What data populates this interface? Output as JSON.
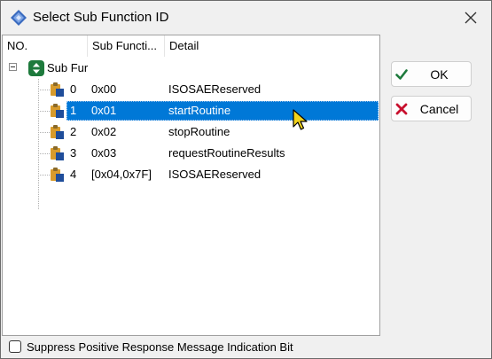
{
  "window": {
    "title": "Select Sub Function ID",
    "colors": {
      "selection": "#0078d7",
      "ok_check": "#1e7a3c",
      "cancel_x": "#c8102e"
    }
  },
  "tree": {
    "columns": [
      "NO.",
      "Sub Functi...",
      "Detail"
    ],
    "root": {
      "label": "Sub Fur",
      "expanded": true,
      "icon": "root-node-icon"
    },
    "rows": [
      {
        "no": "0",
        "sub": "0x00",
        "detail": "ISOSAEReserved",
        "selected": false
      },
      {
        "no": "1",
        "sub": "0x01",
        "detail": "startRoutine",
        "selected": true
      },
      {
        "no": "2",
        "sub": "0x02",
        "detail": "stopRoutine",
        "selected": false
      },
      {
        "no": "3",
        "sub": "0x03",
        "detail": "requestRoutineResults",
        "selected": false
      },
      {
        "no": "4",
        "sub": "[0x04,0x7F]",
        "detail": "ISOSAEReserved",
        "selected": false
      }
    ]
  },
  "buttons": {
    "ok": "OK",
    "cancel": "Cancel"
  },
  "footer": {
    "checkbox_label": "Suppress Positive Response Message Indication Bit",
    "checked": false
  }
}
